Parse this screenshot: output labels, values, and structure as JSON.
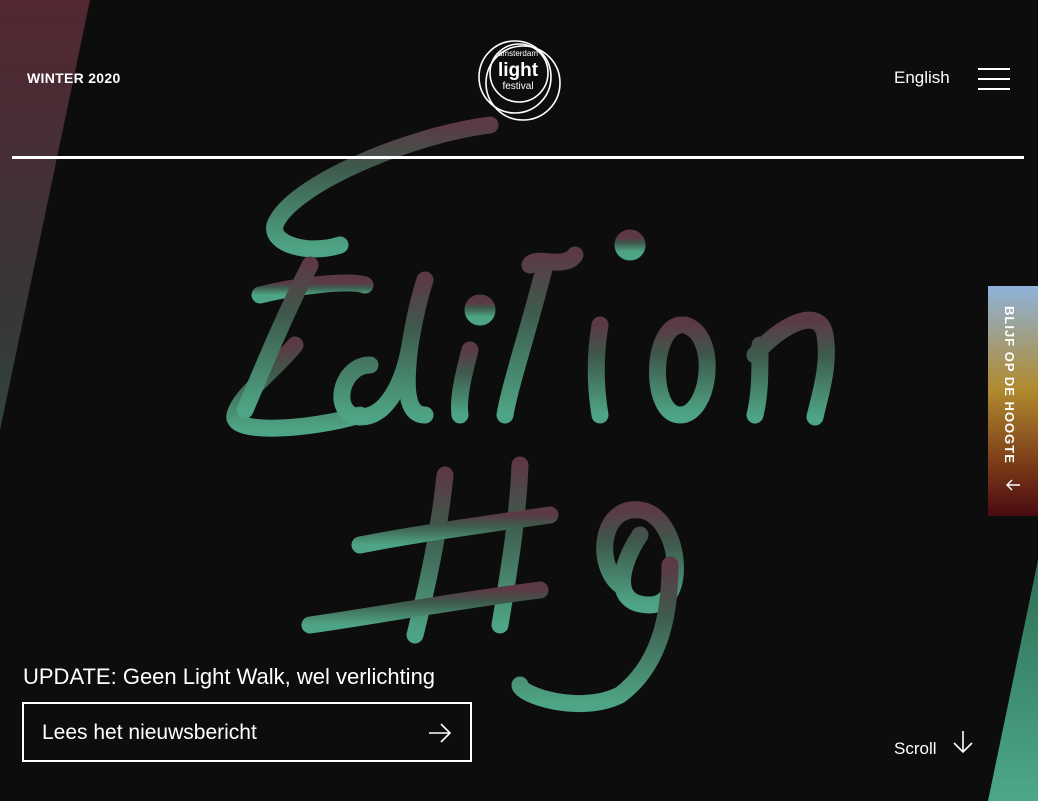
{
  "header": {
    "season": "WINTER 2020",
    "logo": {
      "line1": "amsterdam",
      "line2": "light",
      "line3": "festival"
    },
    "language": "English",
    "menu_icon": "hamburger-menu-icon"
  },
  "hero": {
    "artwork_icon": "edition-9-lettering",
    "colors": {
      "gradient_top": "#5b3a45",
      "gradient_mid": "#3e5a4c",
      "gradient_bottom": "#4ea585"
    }
  },
  "side_tab": {
    "label": "BLIJF OP DE HOOGTE",
    "icon": "arrow-left-icon"
  },
  "update": {
    "title": "UPDATE: Geen Light Walk, wel verlichting",
    "button_label": "Lees het nieuwsbericht",
    "button_icon": "arrow-right-icon"
  },
  "scroll": {
    "label": "Scroll",
    "icon": "arrow-down-icon"
  }
}
